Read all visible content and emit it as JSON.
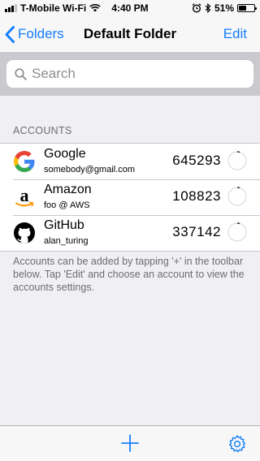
{
  "status_bar": {
    "carrier": "T-Mobile Wi-Fi",
    "time": "4:40 PM",
    "battery_percent": "51%",
    "battery_level": 0.51
  },
  "nav": {
    "back_label": "Folders",
    "title": "Default Folder",
    "edit_label": "Edit"
  },
  "search": {
    "placeholder": "Search"
  },
  "accounts_section": {
    "header": "ACCOUNTS",
    "items": [
      {
        "name": "Google",
        "subtitle": "somebody@gmail.com",
        "code": "645293",
        "icon": "google-logo-icon"
      },
      {
        "name": "Amazon",
        "subtitle": "foo @ AWS",
        "code": "108823",
        "icon": "amazon-logo-icon"
      },
      {
        "name": "GitHub",
        "subtitle": "alan_turing",
        "code": "337142",
        "icon": "github-logo-icon"
      }
    ],
    "footer": "Accounts can be added by tapping '+' in the toolbar below. Tap 'Edit' and choose an account to view the accounts settings."
  },
  "colors": {
    "accent": "#157efb",
    "background": "#efeff4",
    "secondary_text": "#6d6d72"
  },
  "toolbar": {
    "add_icon": "plus-icon",
    "settings_icon": "gear-icon"
  }
}
